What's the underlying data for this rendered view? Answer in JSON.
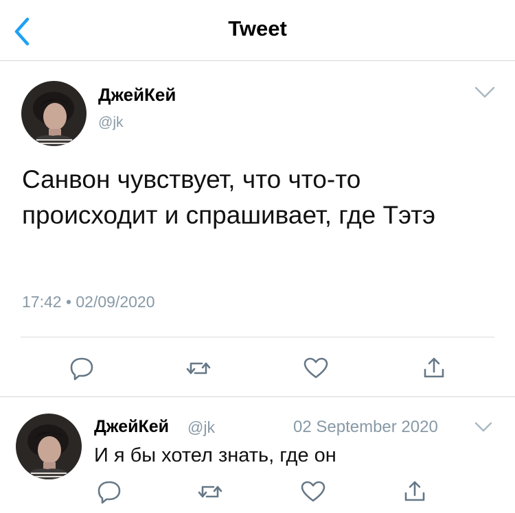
{
  "header": {
    "title": "Tweet"
  },
  "main_tweet": {
    "author_name": "ДжейКей",
    "author_handle": "@jk",
    "text": "Санвон чувствует, что что-то происходит и спрашивает, где Тэтэ",
    "timestamp": "17:42 • 02/09/2020"
  },
  "reply": {
    "author_name": "ДжейКей",
    "author_handle": "@jk",
    "date": "02 September 2020",
    "text": "И я бы хотел знать, где он"
  },
  "colors": {
    "accent": "#1da1f2",
    "secondary_text": "#8899a6",
    "divider": "#d6d6d6"
  },
  "icons": [
    "back-arrow-icon",
    "chevron-down-icon",
    "reply-icon",
    "retweet-icon",
    "like-icon",
    "share-icon"
  ]
}
